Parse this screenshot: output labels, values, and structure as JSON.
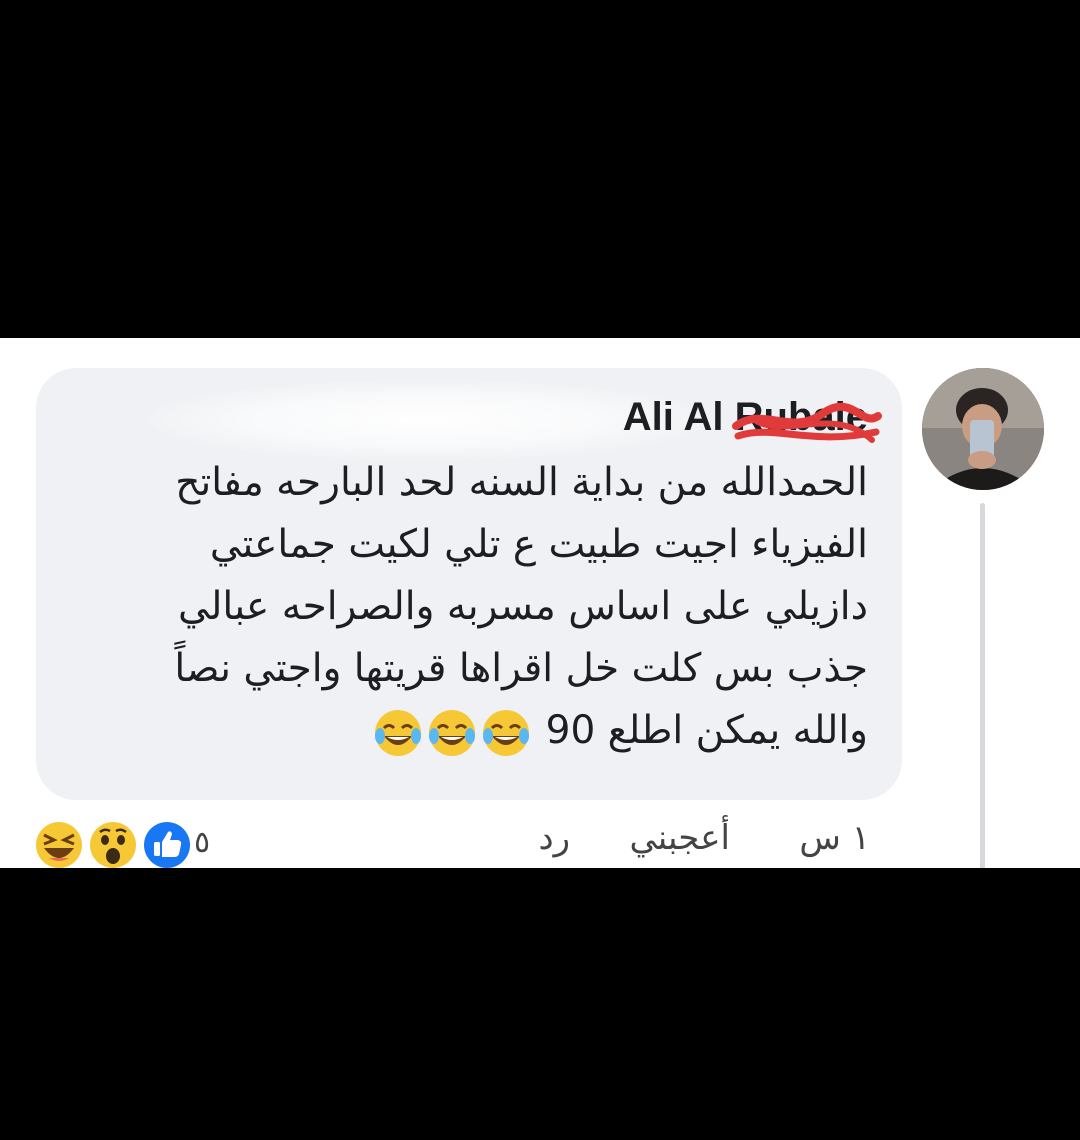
{
  "comment": {
    "author": "Ali Al Rubaie",
    "lines": [
      "الحمدالله من بداية السنه لحد البارحه مفاتح",
      "الفيزياء اجيت طبيت ع تلي لكيت جماعتي",
      "دازيلي على اساس مسربه والصراحه عبالي",
      "جذب بس كلت خل اقراها قريتها واجتي نصاً"
    ],
    "last_line": "والله يمكن اطلع 90",
    "inline_emoji": "face-with-tears-of-joy"
  },
  "actions": {
    "time": "١ س",
    "like_label": "أعجبني",
    "reply_label": "رد"
  },
  "reactions": {
    "icons": [
      "laughing-emoji",
      "wow-emoji",
      "like-icon"
    ],
    "count": "٥"
  },
  "colors": {
    "bubble": "#eff1f4",
    "text": "#1c1e21",
    "redaction": "#e03a3a",
    "like_blue": "#1877f2",
    "emoji_yellow": "#f7c836"
  }
}
